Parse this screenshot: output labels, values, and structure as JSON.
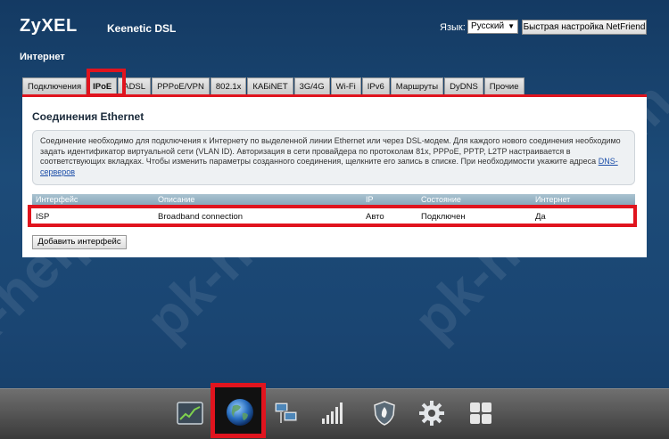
{
  "header": {
    "logo": "ZyXEL",
    "model": "Keenetic DSL",
    "lang_label": "Язык:",
    "lang_value": "Русский",
    "quick_setup": "Быстрая настройка NetFriend"
  },
  "section_title": "Интернет",
  "tabs": [
    {
      "label": "Подключения",
      "active": false
    },
    {
      "label": "IPoE",
      "active": true
    },
    {
      "label": "ADSL",
      "active": false
    },
    {
      "label": "PPPoE/VPN",
      "active": false
    },
    {
      "label": "802.1x",
      "active": false
    },
    {
      "label": "КАБiNET",
      "active": false
    },
    {
      "label": "3G/4G",
      "active": false
    },
    {
      "label": "Wi-Fi",
      "active": false
    },
    {
      "label": "IPv6",
      "active": false
    },
    {
      "label": "Маршруты",
      "active": false
    },
    {
      "label": "DyDNS",
      "active": false
    },
    {
      "label": "Прочие",
      "active": false
    }
  ],
  "panel": {
    "title": "Соединения Ethernet",
    "info_text": "Соединение необходимо для подключения к Интернету по выделенной линии Ethernet или через DSL-модем. Для каждого нового соединения необходимо задать идентификатор виртуальной сети (VLAN ID). Авторизация в сети провайдера по протоколам 81x, PPPoE, PPTP, L2TP настраивается в соответствующих вкладках. Чтобы изменить параметры созданного соединения, щелкните его запись в списке. При необходимости укажите адреса",
    "info_link": "DNS-серверов",
    "columns": {
      "interface": "Интерфейс",
      "description": "Описание",
      "ip": "IP",
      "state": "Состояние",
      "internet": "Интернет"
    },
    "rows": [
      {
        "interface": "ISP",
        "description": "Broadband connection",
        "ip": "Авто",
        "state": "Подключен",
        "internet": "Да"
      }
    ],
    "add_button": "Добавить интерфейс"
  },
  "watermark": "pk-help.com",
  "bottom_nav": [
    {
      "icon": "chart-icon"
    },
    {
      "icon": "globe-icon",
      "active": true
    },
    {
      "icon": "network-icon"
    },
    {
      "icon": "signal-bars-icon"
    },
    {
      "icon": "shield-icon"
    },
    {
      "icon": "gear-icon"
    },
    {
      "icon": "grid-icon"
    }
  ],
  "colors": {
    "highlight": "#e0141e",
    "background": "#1c4b78",
    "table_header": "#94b1c2"
  }
}
